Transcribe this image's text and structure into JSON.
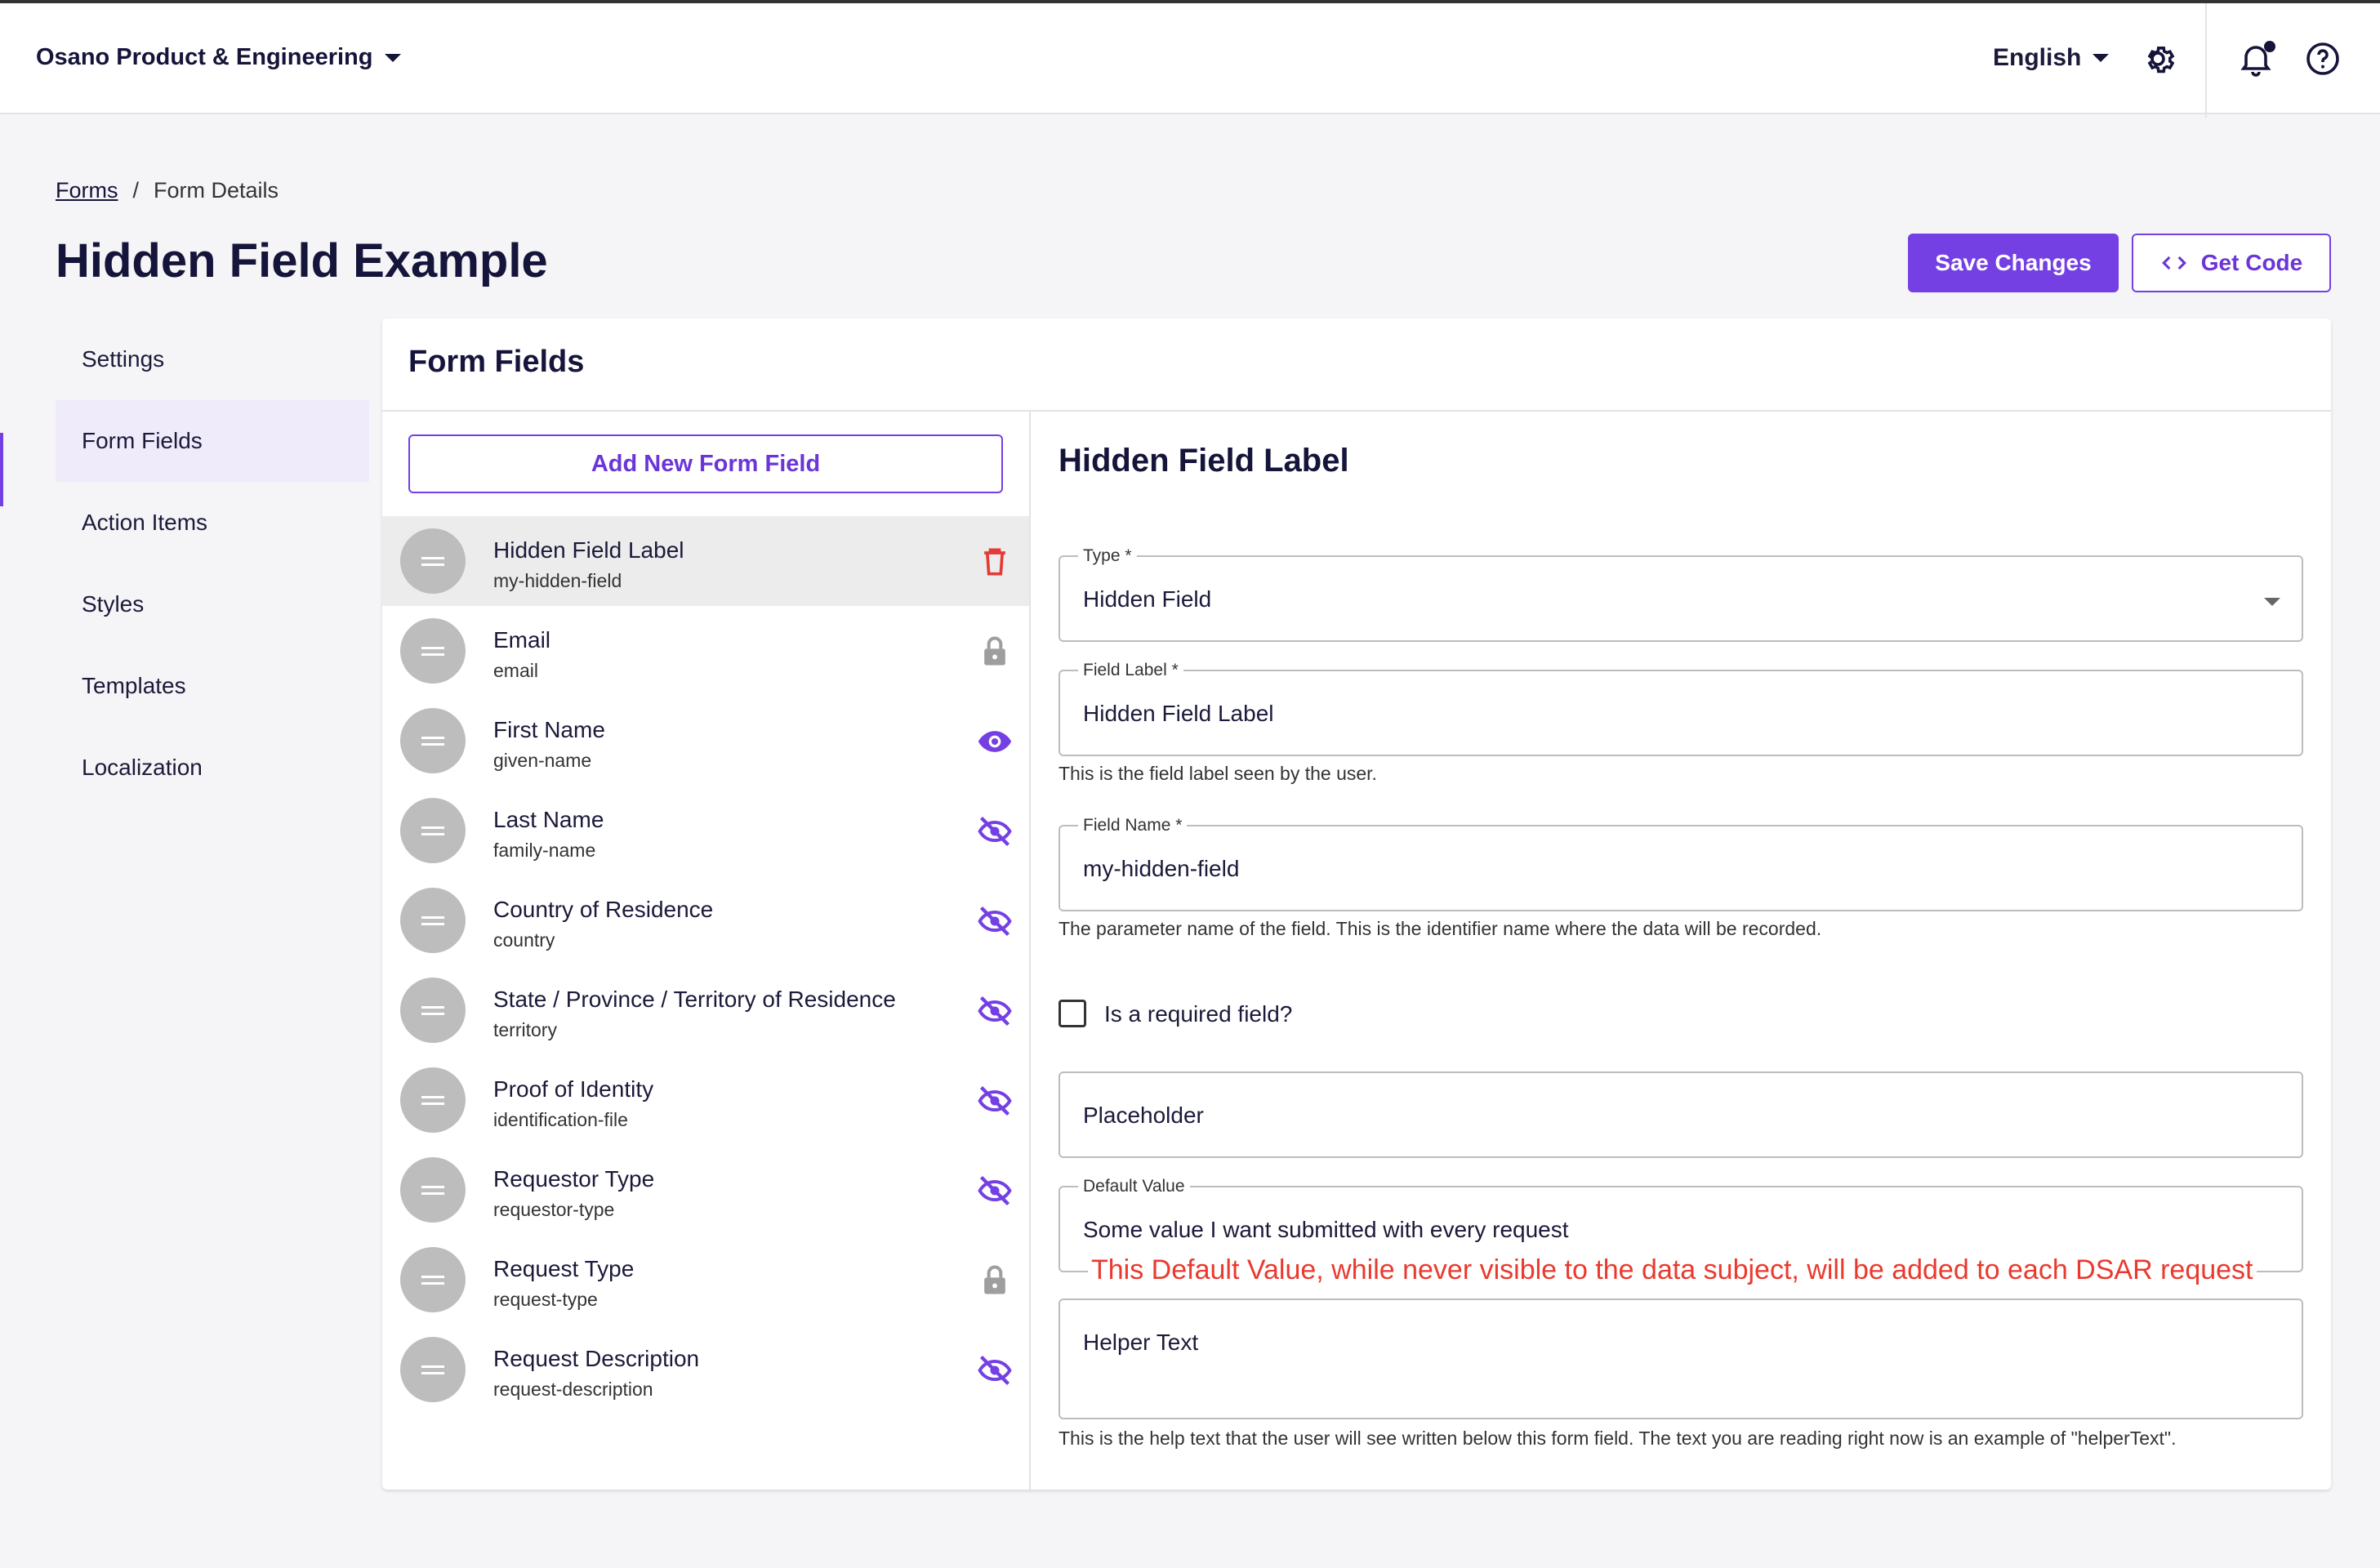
{
  "topbar": {
    "org_name": "Osano Product & Engineering",
    "language": "English",
    "icons": [
      "gear-icon",
      "bell-icon",
      "help-icon"
    ]
  },
  "breadcrumb": {
    "root": "Forms",
    "separator": "/",
    "current": "Form Details"
  },
  "page": {
    "title": "Hidden Field Example",
    "save_label": "Save Changes",
    "code_label": "Get Code"
  },
  "sidebar": {
    "items": [
      {
        "label": "Settings",
        "active": false
      },
      {
        "label": "Form Fields",
        "active": true
      },
      {
        "label": "Action Items",
        "active": false
      },
      {
        "label": "Styles",
        "active": false
      },
      {
        "label": "Templates",
        "active": false
      },
      {
        "label": "Localization",
        "active": false
      }
    ]
  },
  "panel": {
    "title": "Form Fields",
    "add_label": "Add New Form Field",
    "fields": [
      {
        "label": "Hidden Field Label",
        "name": "my-hidden-field",
        "icon": "trash-icon",
        "selected": true
      },
      {
        "label": "Email",
        "name": "email",
        "icon": "lock-icon",
        "selected": false
      },
      {
        "label": "First Name",
        "name": "given-name",
        "icon": "eye-icon",
        "selected": false
      },
      {
        "label": "Last Name",
        "name": "family-name",
        "icon": "eye-off-icon",
        "selected": false
      },
      {
        "label": "Country of Residence",
        "name": "country",
        "icon": "eye-off-icon",
        "selected": false
      },
      {
        "label": "State / Province / Territory of Residence",
        "name": "territory",
        "icon": "eye-off-icon",
        "selected": false
      },
      {
        "label": "Proof of Identity",
        "name": "identification-file",
        "icon": "eye-off-icon",
        "selected": false
      },
      {
        "label": "Requestor Type",
        "name": "requestor-type",
        "icon": "eye-off-icon",
        "selected": false
      },
      {
        "label": "Request Type",
        "name": "request-type",
        "icon": "lock-icon",
        "selected": false
      },
      {
        "label": "Request Description",
        "name": "request-description",
        "icon": "eye-off-icon",
        "selected": false
      }
    ]
  },
  "detail": {
    "title": "Hidden Field Label",
    "type_legend": "Type *",
    "type_value": "Hidden Field",
    "label_legend": "Field Label *",
    "label_value": "Hidden Field Label",
    "label_helper": "This is the field label seen by the user.",
    "name_legend": "Field Name *",
    "name_value": "my-hidden-field",
    "name_helper": "The parameter name of the field. This is the identifier name where the data will be recorded.",
    "required_label": "Is a required field?",
    "required_checked": false,
    "placeholder_label": "Placeholder",
    "default_legend": "Default Value",
    "default_value": "Some value I want submitted with every request",
    "helper_text_label": "Helper Text",
    "helper_text_helper": "This is the help text that the user will see written below this form field. The text you are reading right now is an example of \"helperText\"."
  },
  "annotation": "This Default Value, while never visible to the data subject, will be added to each DSAR request",
  "colors": {
    "accent": "#7540e3",
    "danger": "#e53935",
    "muted_icon": "#9e9e9e",
    "annotation": "#ea3a2e"
  }
}
